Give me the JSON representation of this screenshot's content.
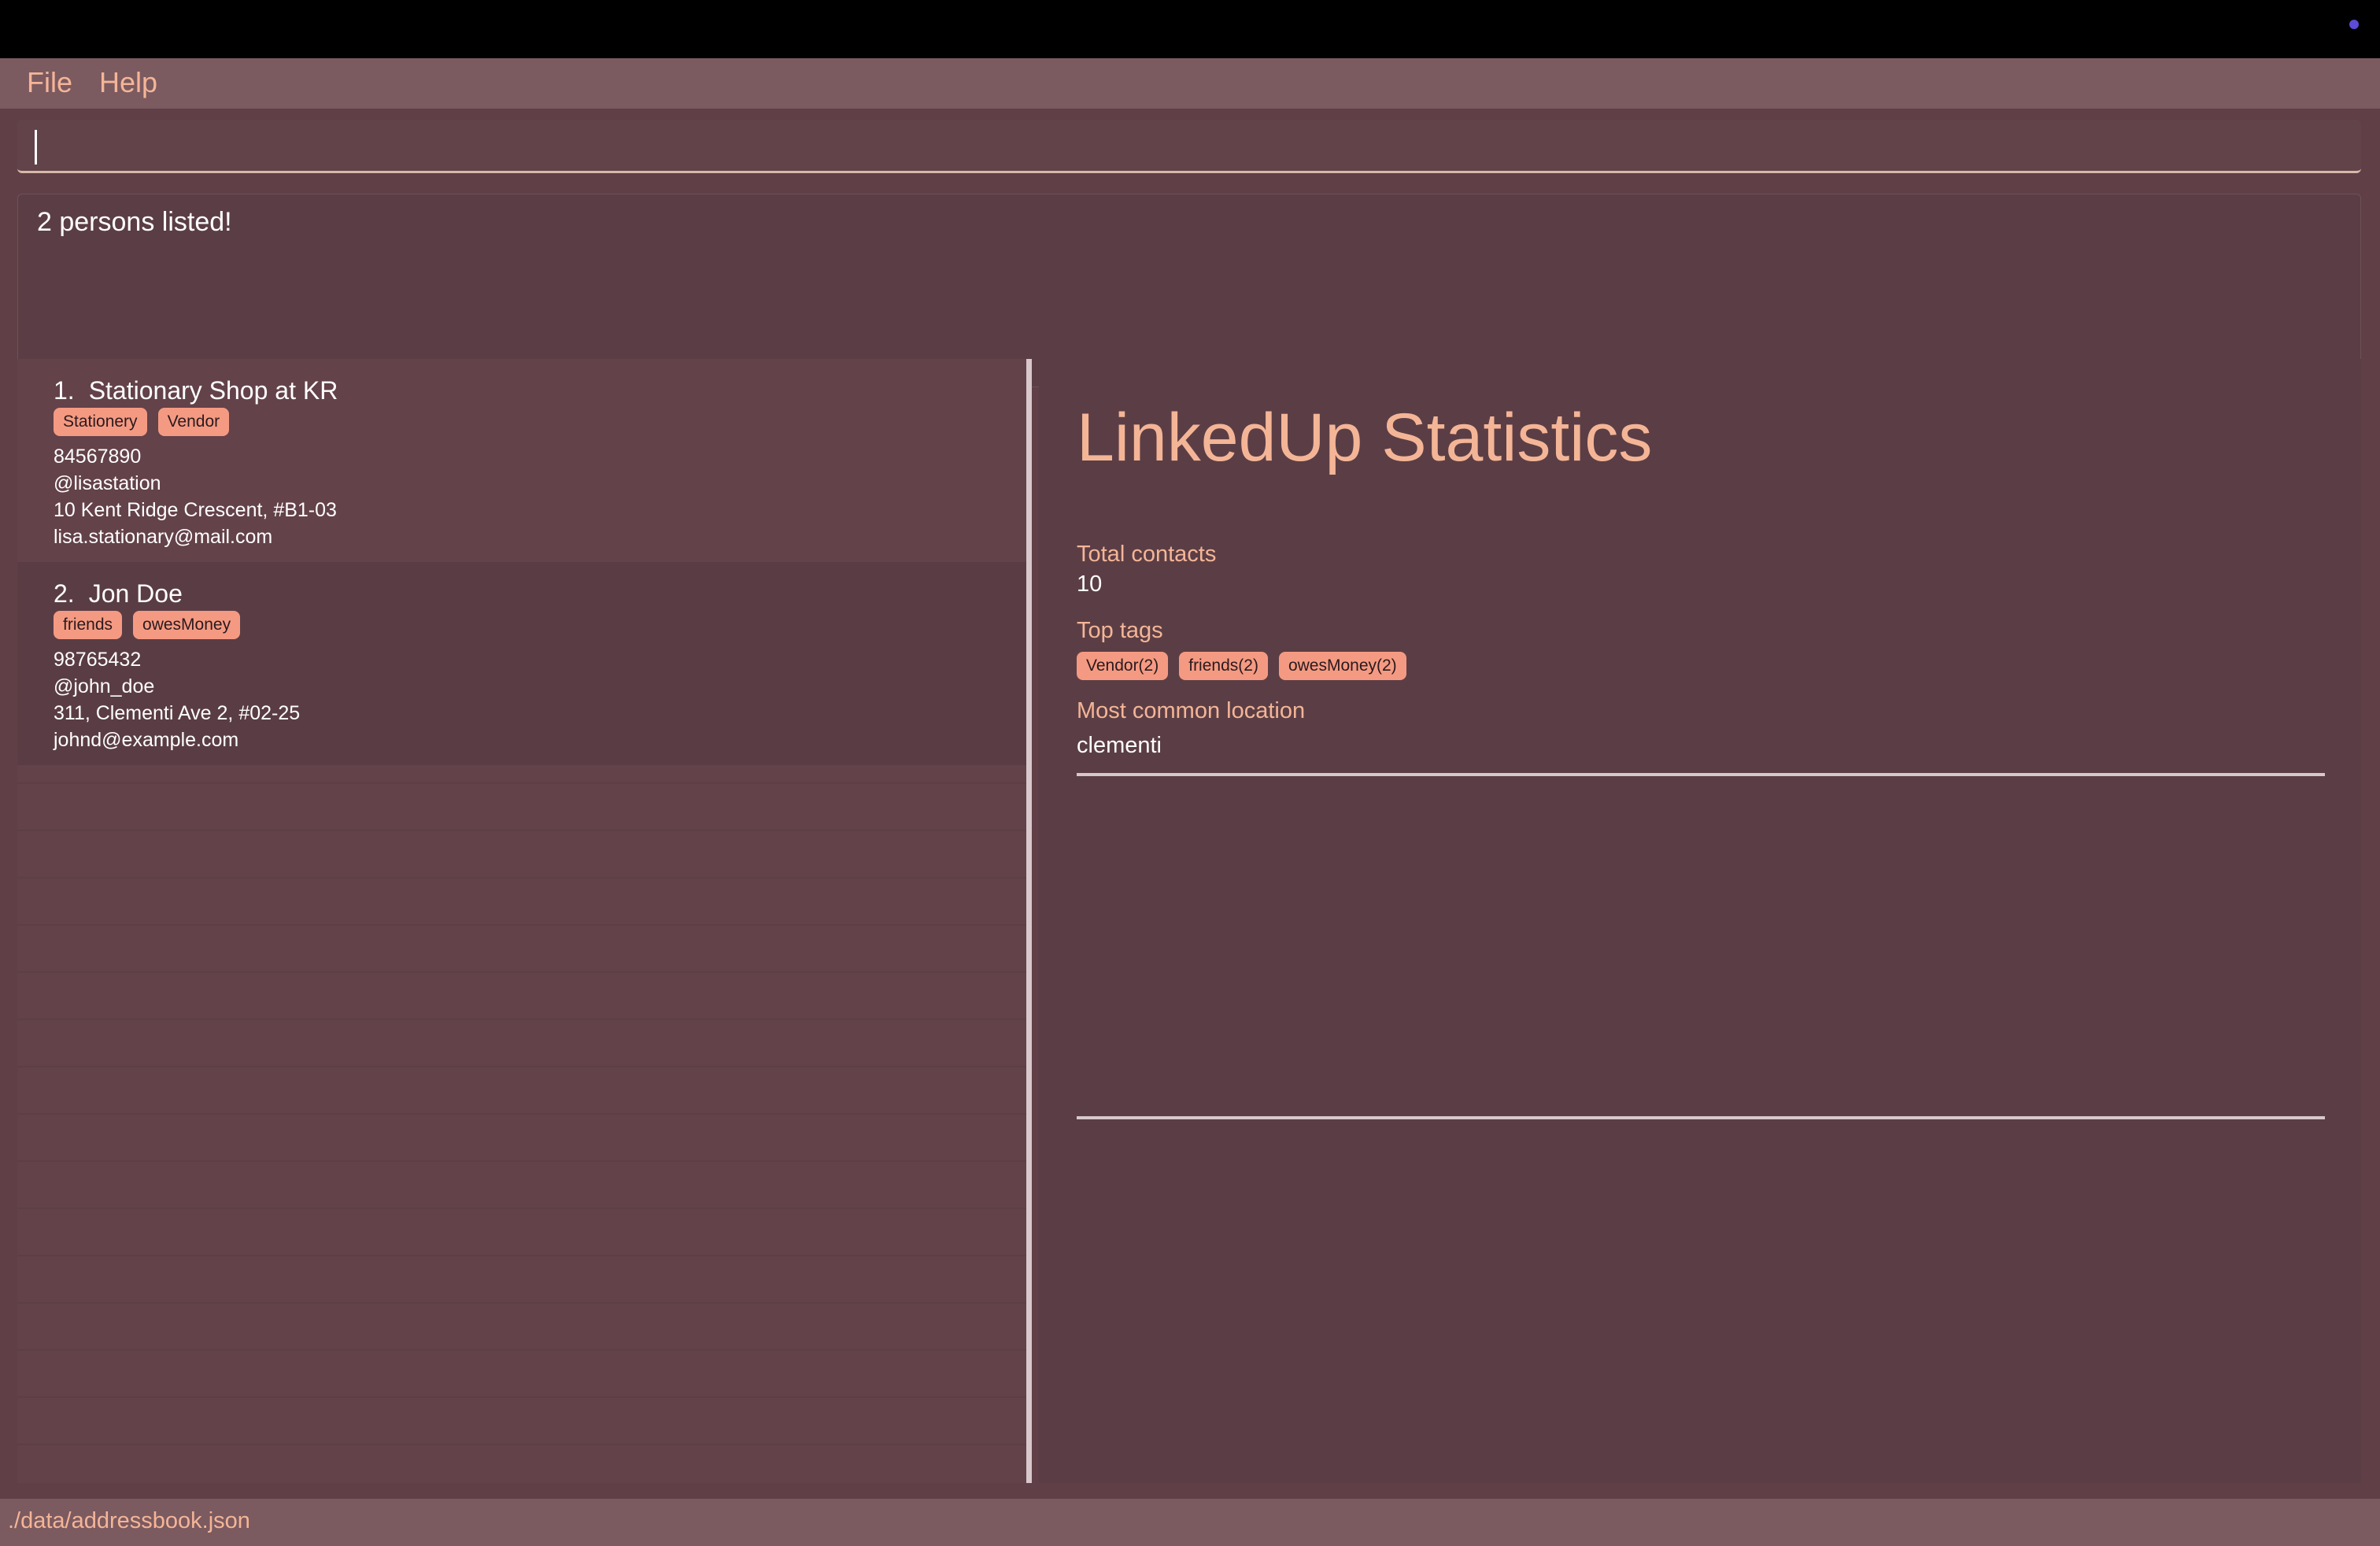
{
  "colors": {
    "accent": "#f4b597",
    "tag_background": "#f59a82",
    "status_dot": "#5b4bd6",
    "text": "#ffffff"
  },
  "menu": {
    "file_label": "File",
    "help_label": "Help"
  },
  "command": {
    "value": "",
    "placeholder": ""
  },
  "result": {
    "message": "2 persons listed!"
  },
  "persons": [
    {
      "index": "1.",
      "name": "Stationary Shop at KR",
      "tags": [
        "Stationery",
        "Vendor"
      ],
      "phone": "84567890",
      "telegram": "@lisastation",
      "address": "10 Kent Ridge Crescent, #B1-03",
      "email": "lisa.stationary@mail.com"
    },
    {
      "index": "2.",
      "name": "Jon Doe",
      "tags": [
        "friends",
        "owesMoney"
      ],
      "phone": "98765432",
      "telegram": "@john_doe",
      "address": "311, Clementi Ave 2, #02-25",
      "email": "johnd@example.com"
    }
  ],
  "stats": {
    "title": "LinkedUp Statistics",
    "total_contacts_label": "Total contacts",
    "total_contacts_value": "10",
    "top_tags_label": "Top tags",
    "top_tags": [
      "Vendor(2)",
      "friends(2)",
      "owesMoney(2)"
    ],
    "location_label": "Most common location",
    "location_value": "clementi"
  },
  "status": {
    "file_path": "./data/addressbook.json"
  }
}
